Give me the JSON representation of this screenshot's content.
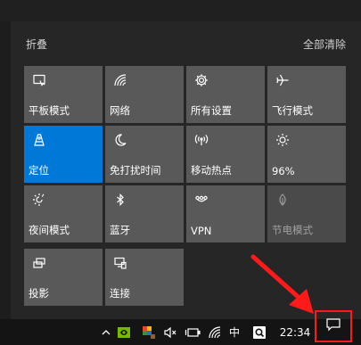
{
  "panel": {
    "collapse_label": "折叠",
    "clear_all_label": "全部清除"
  },
  "tiles": [
    {
      "label": "平板模式",
      "icon": "tablet-mode-icon",
      "state": "off"
    },
    {
      "label": "网络",
      "icon": "network-icon",
      "state": "off"
    },
    {
      "label": "所有设置",
      "icon": "gear-icon",
      "state": "off"
    },
    {
      "label": "飞行模式",
      "icon": "airplane-icon",
      "state": "off"
    },
    {
      "label": "定位",
      "icon": "location-icon",
      "state": "on"
    },
    {
      "label": "免打扰时间",
      "icon": "moon-icon",
      "state": "off"
    },
    {
      "label": "移动热点",
      "icon": "hotspot-icon",
      "state": "off"
    },
    {
      "label": "96%",
      "icon": "brightness-icon",
      "state": "off"
    },
    {
      "label": "夜间模式",
      "icon": "night-light-icon",
      "state": "off"
    },
    {
      "label": "蓝牙",
      "icon": "bluetooth-icon",
      "state": "off"
    },
    {
      "label": "VPN",
      "icon": "vpn-icon",
      "state": "off"
    },
    {
      "label": "节电模式",
      "icon": "battery-saver-icon",
      "state": "disabled"
    },
    {
      "label": "投影",
      "icon": "project-icon",
      "state": "off"
    },
    {
      "label": "连接",
      "icon": "connect-icon",
      "state": "off"
    }
  ],
  "taskbar": {
    "ime_label": "中",
    "time": "22:34",
    "tray_icons": [
      "chevron-up-icon",
      "nvidia-icon",
      "app-tray-icon",
      "speaker-muted-icon",
      "battery-icon",
      "wifi-icon",
      "ime-indicator",
      "search-app-icon"
    ]
  },
  "colors": {
    "accent": "#0078d7",
    "tile": "#595959",
    "highlight": "#ff1a1a"
  }
}
